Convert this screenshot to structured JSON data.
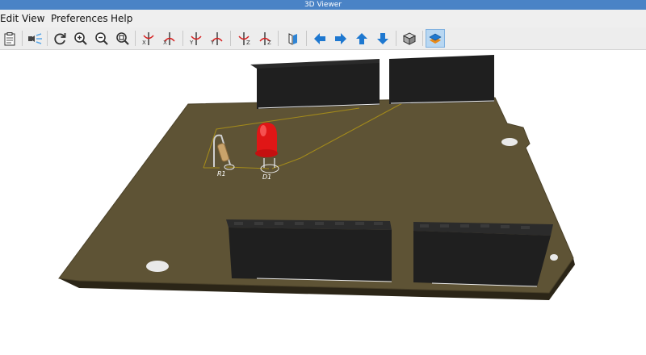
{
  "window": {
    "title": "3D Viewer"
  },
  "menu": {
    "items": [
      "Edit",
      "View",
      "Preferences",
      "Help"
    ]
  },
  "toolbar": {
    "buttons": [
      "copy-image",
      "raytracing-toggle",
      "reload",
      "zoom-in",
      "zoom-out",
      "zoom-fit",
      "rotate-x-cw",
      "rotate-x-ccw",
      "rotate-y-cw",
      "rotate-y-ccw",
      "rotate-z-cw",
      "rotate-z-ccw",
      "flip-board",
      "pan-left",
      "pan-right",
      "pan-up",
      "pan-down",
      "toggle-ortho",
      "render-options"
    ]
  },
  "board": {
    "silkscreen": {
      "r1": "R1",
      "d1": "D1"
    },
    "colors": {
      "board": "#5e5335",
      "board_edge": "#2b2517",
      "trace": "#a38a1b",
      "led": "#e01616",
      "header": "#1f1f1f"
    }
  }
}
